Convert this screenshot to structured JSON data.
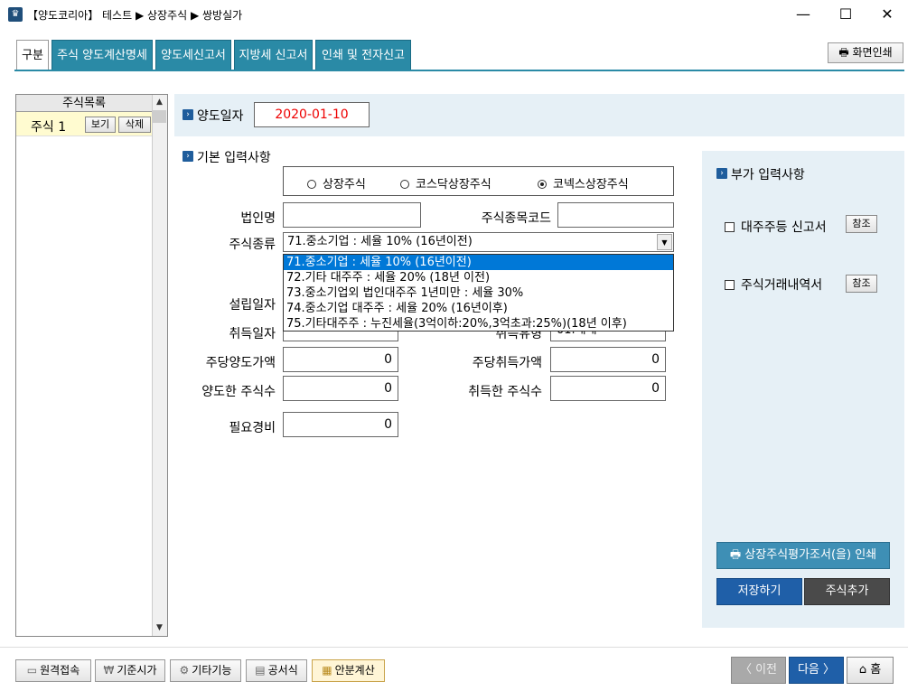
{
  "window": {
    "title": "【양도코리아】 테스트 ▶ 상장주식 ▶ 쌍방실가",
    "minimize": "—",
    "maximize": "☐",
    "close": "✕"
  },
  "tabs": [
    {
      "label": "구분"
    },
    {
      "label": "주식 양도계산명세"
    },
    {
      "label": "양도세신고서"
    },
    {
      "label": "지방세 신고서"
    },
    {
      "label": "인쇄 및 전자신고"
    }
  ],
  "print_screen_label": "화면인쇄",
  "stock_list": {
    "header": "주식목록",
    "items": [
      {
        "label": "주식 1",
        "view": "보기",
        "delete": "삭제"
      }
    ]
  },
  "transfer_date": {
    "label": "양도일자",
    "value": "2020-01-10"
  },
  "basic": {
    "title": "기본 입력사항",
    "radio_options": [
      {
        "label": "상장주식",
        "selected": false
      },
      {
        "label": "코스닥상장주식",
        "selected": false
      },
      {
        "label": "코넥스상장주식",
        "selected": true
      }
    ],
    "corp_name_label": "법인명",
    "stock_code_label": "주식종목코드",
    "stock_type_label": "주식종류",
    "stock_type_value": "71.중소기업 : 세율 10% (16년이전)",
    "stock_type_options": [
      "71.중소기업 : 세율 10% (16년이전)",
      "72.기타 대주주 : 세율 20% (18년 이전)",
      "73.중소기업외 법인대주주 1년미만 : 세율 30%",
      "74.중소기업 대주주 : 세율 20% (16년이후)",
      "75.기타대주주 : 누진세율(3억이하:20%,3억초과:25%)(18년 이후)"
    ],
    "establish_date_label": "설립일자",
    "acquire_date_label": "취득일자",
    "acquire_type_label": "취득유형",
    "acquire_type_value": "01.매매",
    "per_share_transfer_label": "주당양도가액",
    "per_share_transfer_value": "0",
    "per_share_acquire_label": "주당취득가액",
    "per_share_acquire_value": "0",
    "shares_transferred_label": "양도한 주식수",
    "shares_transferred_value": "0",
    "shares_acquired_label": "취득한 주식수",
    "shares_acquired_value": "0",
    "expenses_label": "필요경비",
    "expenses_value": "0"
  },
  "additional": {
    "title": "부가 입력사항",
    "items": [
      {
        "label": "대주주등 신고서",
        "ref": "참조"
      },
      {
        "label": "주식거래내역서",
        "ref": "참조"
      }
    ],
    "print_eval_label": "상장주식평가조서(을) 인쇄",
    "save_label": "저장하기",
    "add_stock_label": "주식추가"
  },
  "footer": {
    "remote": "원격접속",
    "base_price": "기준시가",
    "other": "기타기능",
    "formula": "공서식",
    "prorate": "안분계산",
    "prev": "〈 이전",
    "next": "다음 〉",
    "home": "홈"
  },
  "colors": {
    "tab": "#2a8aa6",
    "accent": "#1f5d9c",
    "date": "#e00000"
  }
}
